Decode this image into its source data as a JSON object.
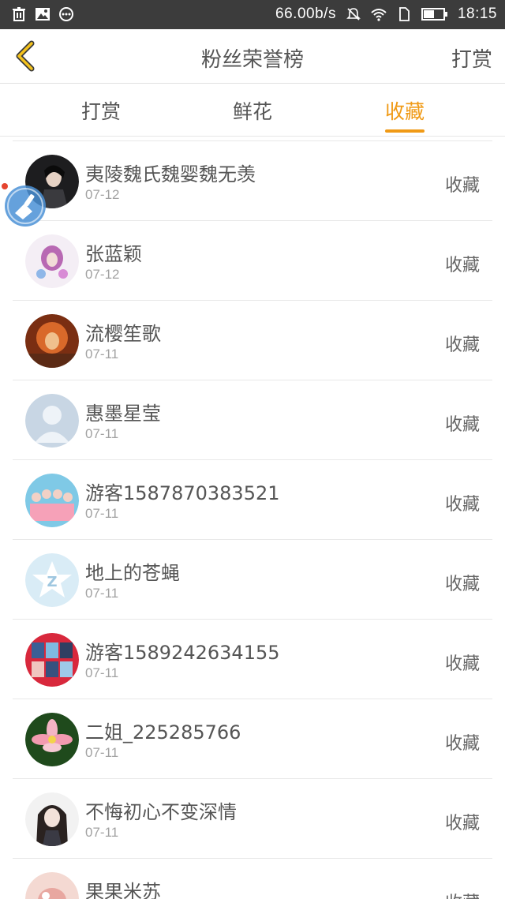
{
  "statusbar": {
    "speed": "66.00b/s",
    "time": "18:15"
  },
  "header": {
    "title": "粉丝荣誉榜",
    "action": "打赏"
  },
  "tabs": [
    {
      "label": "打赏"
    },
    {
      "label": "鲜花"
    },
    {
      "label": "收藏"
    }
  ],
  "active_tab": "收藏",
  "colors": {
    "accent": "#f09a16",
    "statusbar": "#3c3c3c",
    "text": "#555555",
    "subtext": "#a2a2a2"
  },
  "rows": [
    {
      "name": "夷陵魏氏魏婴魏无羡",
      "date": "07-12",
      "action": "收藏"
    },
    {
      "name": "张蓝颖",
      "date": "07-12",
      "action": "收藏"
    },
    {
      "name": "流樱笙歌",
      "date": "07-11",
      "action": "收藏"
    },
    {
      "name": "惠墨星莹",
      "date": "07-11",
      "action": "收藏"
    },
    {
      "name": "游客1587870383521",
      "date": "07-11",
      "action": "收藏"
    },
    {
      "name": "地上的苍蝇",
      "date": "07-11",
      "action": "收藏"
    },
    {
      "name": "游客1589242634155",
      "date": "07-11",
      "action": "收藏"
    },
    {
      "name": "二姐_225285766",
      "date": "07-11",
      "action": "收藏"
    },
    {
      "name": "不悔初心不变深情",
      "date": "07-11",
      "action": "收藏"
    },
    {
      "name": "果果米苏",
      "date": "",
      "action": "收藏"
    }
  ]
}
